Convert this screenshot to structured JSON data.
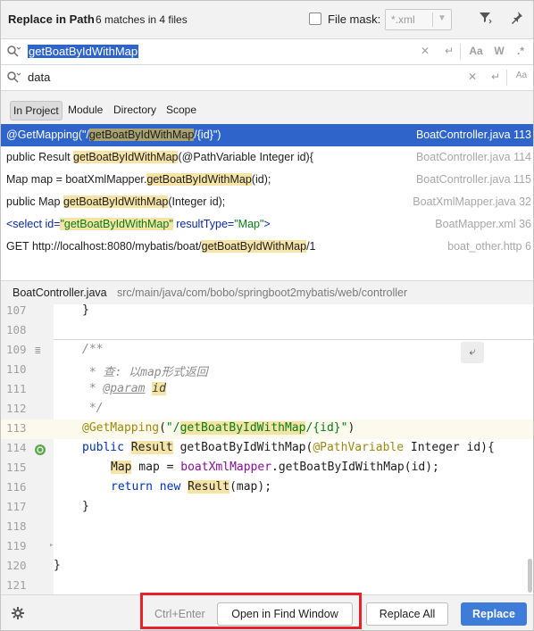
{
  "dialog": {
    "title": "Replace in Path",
    "subtitle": "6 matches in 4 files",
    "file_mask_label": "File mask:",
    "file_mask_value": "*.xml"
  },
  "search": {
    "find_text": "getBoatByIdWithMap",
    "replace_text": "data",
    "match_case_label": "Aa",
    "words_label": "W",
    "regex_label": ".*"
  },
  "scope_tabs": [
    {
      "label": "In Project",
      "active": true
    },
    {
      "label": "Module",
      "active": false
    },
    {
      "label": "Directory",
      "active": false
    },
    {
      "label": "Scope",
      "active": false
    }
  ],
  "results": [
    {
      "pre": "@GetMapping(\"/",
      "match": "getBoatByIdWithMap",
      "post": "/{id}\")",
      "file": "BoatController.java 113"
    },
    {
      "pre": "public Result ",
      "match": "getBoatByIdWithMap",
      "post": "(@PathVariable Integer id){",
      "file": "BoatController.java 114"
    },
    {
      "pre": "Map map = boatXmlMapper.",
      "match": "getBoatByIdWithMap",
      "post": "(id);",
      "file": "BoatController.java 115"
    },
    {
      "pre": "public Map ",
      "match": "getBoatByIdWithMap",
      "post": "(Integer id);",
      "file": "BoatXmlMapper.java 32"
    },
    {
      "pre_tag": "<select ",
      "pre_attr": "id=",
      "match": "\"getBoatByIdWithMap\"",
      "post_attr": " resultType=",
      "post_val": "\"Map\"",
      "post_tag": ">",
      "file": "BoatMapper.xml 36"
    },
    {
      "pre": "GET http://localhost:8080/mybatis/boat/",
      "match": "getBoatByIdWithMap",
      "post": "/1",
      "file": "boat_other.http 6"
    }
  ],
  "preview": {
    "file": "BoatController.java",
    "path": "src/main/java/com/bobo/springboot2mybatis/web/controller"
  },
  "editor": {
    "line_numbers": [
      "107",
      "108",
      "109",
      "110",
      "111",
      "112",
      "113",
      "114",
      "115",
      "116",
      "117",
      "118",
      "119",
      "120",
      "121"
    ],
    "l107": "}",
    "l109": "/**",
    "l110": " * 查: 以map形式返回",
    "l111_star": " * ",
    "l111_tag": "@param",
    "l111_param": "id",
    "l112": " */",
    "l113_ann": "@GetMapping",
    "l113_open": "(",
    "l113_str1": "\"/",
    "l113_hl": "getBoatByIdWithMap",
    "l113_str2": "/{id}\"",
    "l113_close": ")",
    "l114_kw": "public",
    "l114_type": "Result",
    "l114_name": " getBoatByIdWithMap(",
    "l114_ann": "@PathVariable",
    "l114_rest": " Integer id){",
    "l115_type": "Map",
    "l115_mid": " map = ",
    "l115_field": "boatXmlMapper",
    "l115_rest": ".getBoatByIdWithMap(id);",
    "l116_kw1": "return",
    "l116_kw2": "new",
    "l116_type": "Result",
    "l116_rest": "(map);",
    "l117": "}",
    "l120": "}"
  },
  "footer": {
    "shortcut": "Ctrl+Enter",
    "open_find_window": "Open in Find Window",
    "replace_all": "Replace All",
    "replace": "Replace"
  }
}
